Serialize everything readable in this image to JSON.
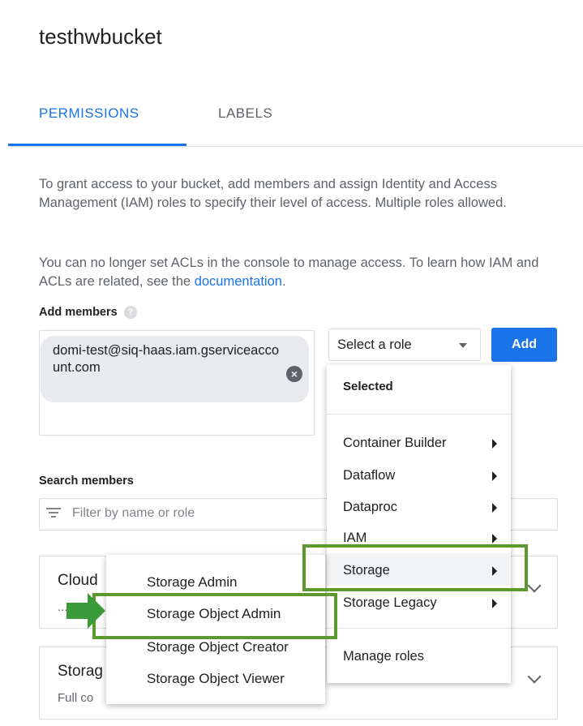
{
  "bucket_title": "testhwbucket",
  "tabs": [
    {
      "label": "PERMISSIONS",
      "active": true
    },
    {
      "label": "LABELS",
      "active": false
    }
  ],
  "intro": {
    "text": "To grant access to your bucket, add members and assign Identity and Access Management (IAM) roles to specify their level of access. Multiple roles allowed.",
    "acl_text": "You can no longer set ACLs in the console to manage access. To learn how IAM and ACLs are related, see the ",
    "acl_link": "documentation",
    "acl_end": "."
  },
  "add_members": {
    "label": "Add members",
    "help_icon": "help-circle-icon",
    "chip_text": "domi-test@siq-haas.iam.gserviceaccount.com",
    "chip_close_icon": "close-circle-icon",
    "role_placeholder": "Select a role",
    "add_button": "Add"
  },
  "search": {
    "label": "Search members",
    "placeholder": "Filter by name or role",
    "icon": "filter-icon"
  },
  "cards": [
    {
      "title": "Cloud",
      "subtitle": "...e"
    },
    {
      "title": "Storag",
      "subtitle": "Full co"
    }
  ],
  "role_menu": {
    "header": "Selected",
    "items": [
      "Container Builder",
      "Dataflow",
      "Dataproc",
      "IAM",
      "Storage",
      "Storage Legacy"
    ],
    "footer_link": "Manage roles"
  },
  "storage_submenu": {
    "items": [
      "Storage Admin",
      "Storage Object Admin",
      "Storage Object Creator",
      "Storage Object Viewer"
    ]
  },
  "colors": {
    "accent": "#1a73e8",
    "highlight": "#5c9a2f"
  }
}
